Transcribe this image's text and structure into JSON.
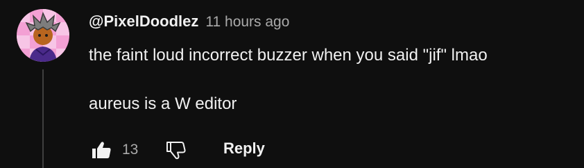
{
  "comment": {
    "author": "@PixelDoodlez",
    "timestamp": "11 hours ago",
    "body_lines": [
      "the faint loud incorrect buzzer when you said \"jif\" lmao",
      "",
      "aureus is a W editor"
    ],
    "like_count": "13",
    "reply_label": "Reply"
  },
  "icons": {
    "like": "thumbs-up-icon",
    "dislike": "thumbs-down-icon",
    "avatar": "pixel-character-avatar"
  },
  "colors": {
    "background": "#0f0f0f",
    "text_primary": "#f1f1f1",
    "text_secondary": "#aaaaaa",
    "thread_line": "#3f3f3f",
    "avatar_pink": "#f3a0d4",
    "avatar_light_pink": "#f7c5e6"
  }
}
